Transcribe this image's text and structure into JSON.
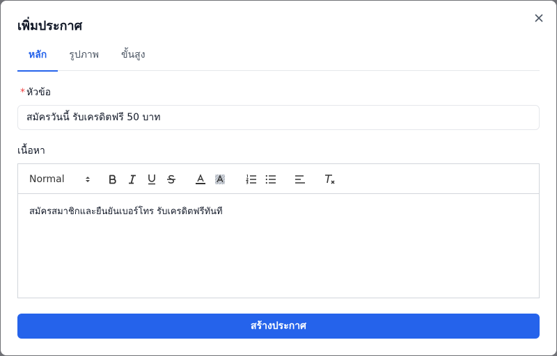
{
  "dialog": {
    "title": "เพิ่มประกาศ"
  },
  "tabs": [
    {
      "label": "หลัก",
      "active": true
    },
    {
      "label": "รูปภาพ",
      "active": false
    },
    {
      "label": "ขั้นสูง",
      "active": false
    }
  ],
  "form": {
    "title_label_required": "*",
    "title_label": "หัวข้อ",
    "title_value": "สมัครวันนี้ รับเครดิตฟรี 50 บาท",
    "content_label": "เนื้อหา",
    "content_value": "สมัครสมาชิกและยืนยันเบอร์โทร รับเครดิตฟรีทันที",
    "format_selected": "Normal",
    "submit_label": "สร้างประกาศ"
  },
  "colors": {
    "accent": "#2563eb",
    "required": "#ef4444"
  }
}
